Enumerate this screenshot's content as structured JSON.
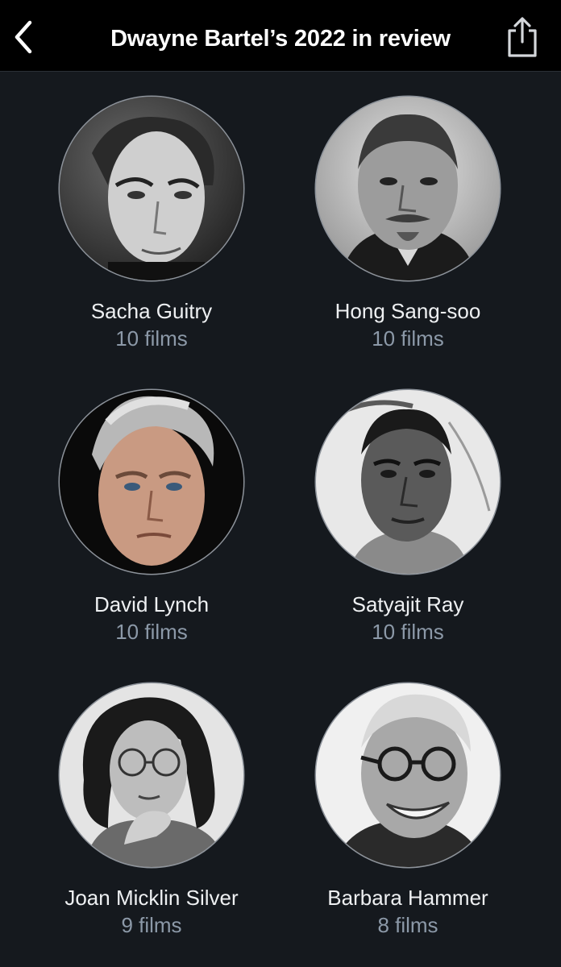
{
  "header": {
    "title": "Dwayne Bartel’s 2022 in review",
    "back_icon": "chevron-left-icon",
    "share_icon": "share-icon"
  },
  "colors": {
    "header_bg": "#000000",
    "page_bg": "#15191e",
    "name_text": "#eef0f2",
    "count_text": "#8c99a8"
  },
  "directors": [
    {
      "name": "Sacha Guitry",
      "count": "10 films"
    },
    {
      "name": "Hong Sang-soo",
      "count": "10 films"
    },
    {
      "name": "David Lynch",
      "count": "10 films"
    },
    {
      "name": "Satyajit Ray",
      "count": "10 films"
    },
    {
      "name": "Joan Micklin Silver",
      "count": "9 films"
    },
    {
      "name": "Barbara Hammer",
      "count": "8 films"
    }
  ]
}
